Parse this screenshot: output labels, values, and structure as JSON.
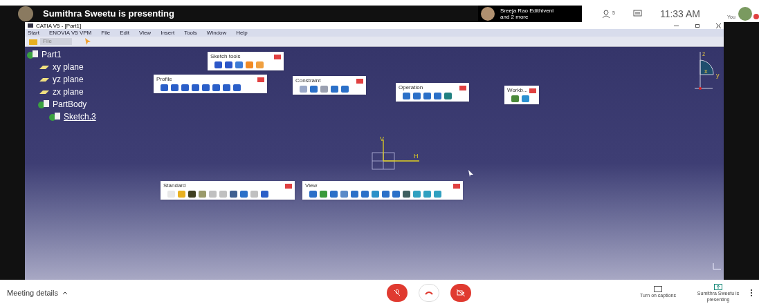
{
  "meet_header": {
    "presenter_text": "Sumithra Sweetu is presenting",
    "participant_tile": {
      "name": "Sreeja Rao Edithiveni",
      "more": "and 2 more"
    },
    "people_count": "5",
    "time": "11:33 AM",
    "self_label": "You"
  },
  "catia": {
    "title": "CATIA V5 - [Part1]",
    "menu": [
      "Start",
      "ENOVIA V5 VPM",
      "File",
      "Edit",
      "View",
      "Insert",
      "Tools",
      "Window",
      "Help"
    ],
    "file_field": {
      "value": "File"
    },
    "tree": [
      {
        "label": "Part1",
        "selected": false,
        "children": [
          {
            "label": "xy plane",
            "selected": false
          },
          {
            "label": "yz plane",
            "selected": false
          },
          {
            "label": "zx plane",
            "selected": false
          },
          {
            "label": "PartBody",
            "selected": false,
            "children": [
              {
                "label": "Sketch.3",
                "selected": true
              }
            ]
          }
        ]
      }
    ],
    "toolbars": [
      {
        "title": "Sketch tools"
      },
      {
        "title": "Profile"
      },
      {
        "title": "Constraint"
      },
      {
        "title": "Operation"
      },
      {
        "title": "Workb..."
      },
      {
        "title": "Standard"
      },
      {
        "title": "View"
      }
    ],
    "sketch_axes": {
      "vertical": "V",
      "horizontal": "H"
    },
    "compass_labels": {
      "z": "z",
      "y": "y",
      "x": "x"
    }
  },
  "meet_footer": {
    "meeting_details": "Meeting details",
    "mic_muted": true,
    "camera_off": true,
    "captions": "Turn on captions",
    "presenting": "Sumithra Sweetu is presenting"
  }
}
